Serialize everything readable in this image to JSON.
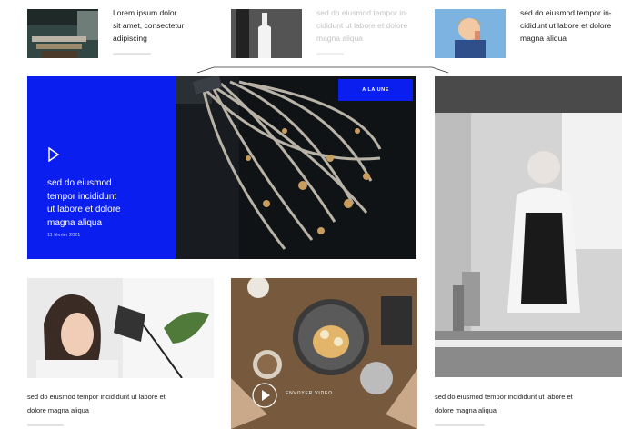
{
  "top_row": [
    {
      "title_lines": [
        "Lorem ipsum dolor",
        "sit amet, consectetur",
        "adipiscing"
      ],
      "image_icon": "desk-image",
      "faded": false
    },
    {
      "title_lines": [
        "sed do eiusmod tempor in-",
        "cididunt ut labore et dolore",
        "magna aliqua"
      ],
      "image_icon": "bottle-image",
      "faded": true
    },
    {
      "title_lines": [
        "sed do eiusmod tempor in-",
        "cididunt ut labore et dolore",
        "magna aliqua"
      ],
      "image_icon": "child-image",
      "faded": false
    }
  ],
  "feature": {
    "badge": "A LA UNE",
    "title_lines": [
      "sed do eiusmod",
      "tempor incididunt",
      "ut labore et dolore",
      "magna aliqua"
    ],
    "date": "11 février 2021",
    "panel_color": "#0a1ef0",
    "play_icon": "play-outline-icon"
  },
  "bottom_cards": [
    {
      "caption_lines": [
        "sed do eiusmod tempor incididunt ut labore et",
        "dolore magna aliqua"
      ],
      "image_icon": "woman-lamp-image"
    },
    {
      "caption_lines": [],
      "image_icon": "pancakes-image",
      "overlay_label": "ENVOYER VIDEO",
      "play_icon": "play-circle-icon"
    },
    {
      "caption_lines": [
        "sed do eiusmod tempor incididunt ut labore et",
        "dolore magna aliqua"
      ],
      "image_icon": "chef-image"
    }
  ]
}
